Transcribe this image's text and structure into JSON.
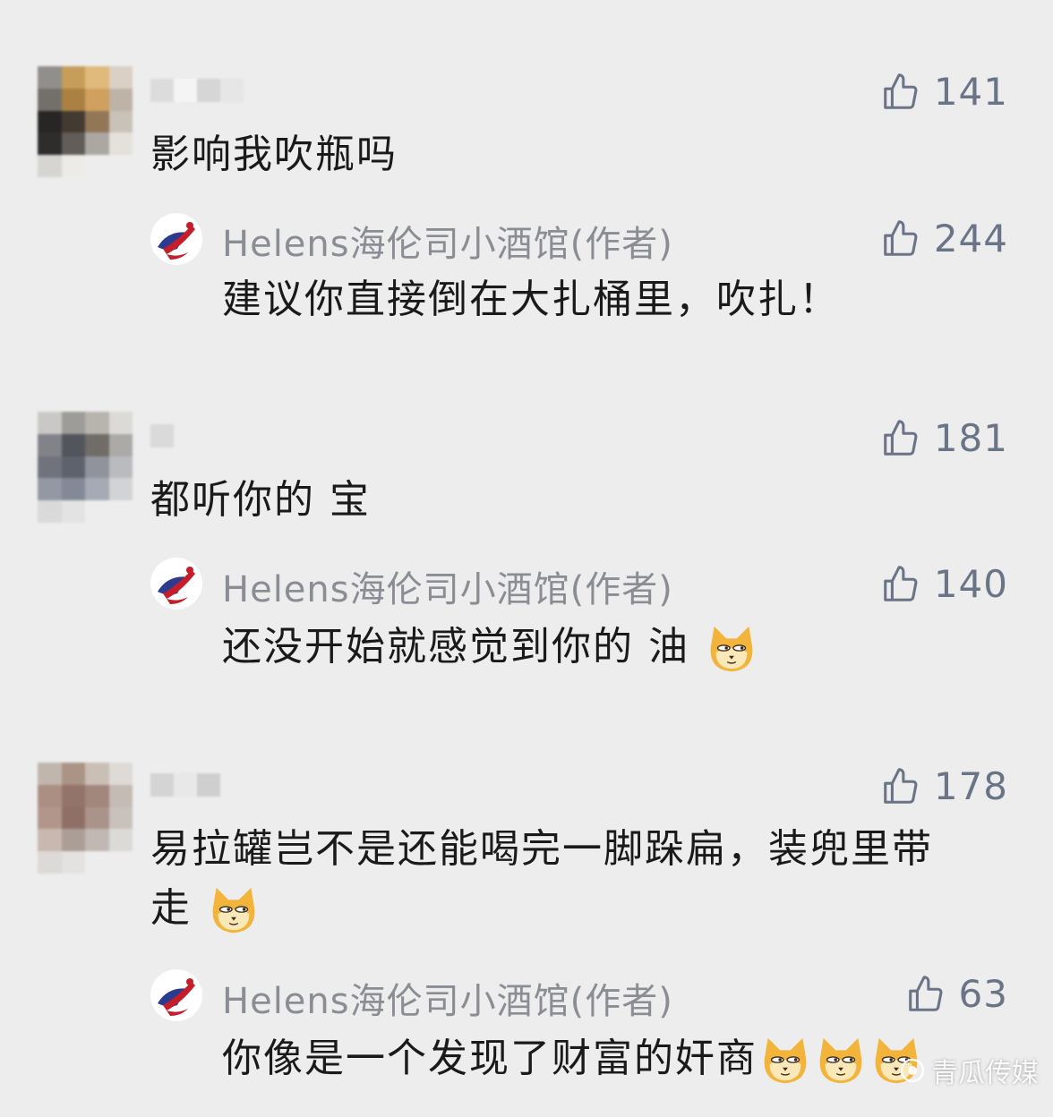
{
  "comments": [
    {
      "likes": "141",
      "text": "影响我吹瓶吗",
      "reply": {
        "author": "Helens海伦司小酒馆(作者)",
        "likes": "244",
        "text": "建议你直接倒在大扎桶里，吹扎！"
      }
    },
    {
      "likes": "181",
      "text": "都听你的 宝",
      "reply": {
        "author": "Helens海伦司小酒馆(作者)",
        "likes": "140",
        "text": "还没开始就感觉到你的 油"
      }
    },
    {
      "likes": "178",
      "text_line1": "易拉罐岂不是还能喝完一脚跺扁，装兜里带",
      "text_line2": "走",
      "reply": {
        "author": "Helens海伦司小酒馆(作者)",
        "likes": "63",
        "text": "你像是一个发现了财富的奸商"
      }
    }
  ],
  "watermark": {
    "text": "青瓜传媒"
  },
  "icons": {
    "like": "thumbs-up-icon",
    "emoji": "doge-emoji-icon"
  }
}
